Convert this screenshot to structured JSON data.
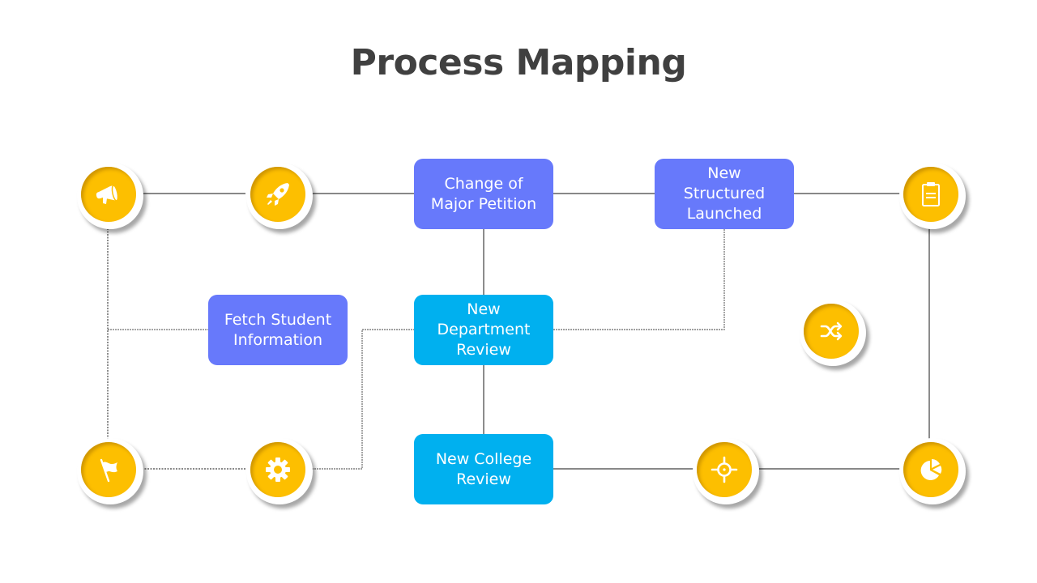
{
  "title": "Process Mapping",
  "colors": {
    "node_yellow": "#fdbf00",
    "box_purple": "#6779fb",
    "box_blue": "#00b0ef",
    "line": "#404040",
    "title": "#404040"
  },
  "boxes": {
    "change_of_major": "Change of\nMajor Petition",
    "new_structured": "New\nStructured\nLaunched",
    "fetch_student": "Fetch Student\nInformation",
    "new_department": "New\nDepartment\nReview",
    "new_college": "New College\nReview"
  },
  "icons": {
    "n1": "megaphone",
    "n2": "rocket",
    "n3": "clipboard",
    "n4": "shuffle",
    "n5": "flag",
    "n6": "gear",
    "n7": "target",
    "n8": "pie-chart"
  }
}
